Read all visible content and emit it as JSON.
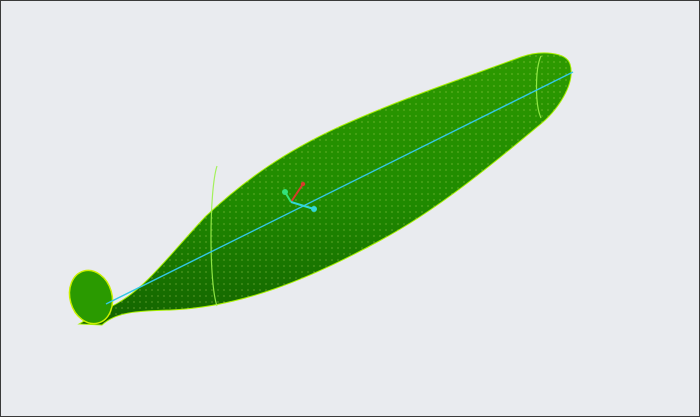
{
  "viewport": {
    "background_color": "#e9ebef",
    "border_color": "#3a3a3a"
  },
  "model": {
    "body_color": "#1f8a00",
    "body_dark_color": "#136300",
    "edge_color": "#a7f000",
    "mesh_point_color": "#e8ef7a",
    "axis_color": "#33c7e6",
    "section_ring_color": "#9bf24a",
    "shape": "tapered-cylindrical-blade-surface"
  },
  "triad": {
    "x_axis_color": "#d63b2b",
    "y_axis_color": "#33e27b",
    "z_axis_color": "#33d6d6",
    "icon": "coordinate-triad-icon"
  }
}
